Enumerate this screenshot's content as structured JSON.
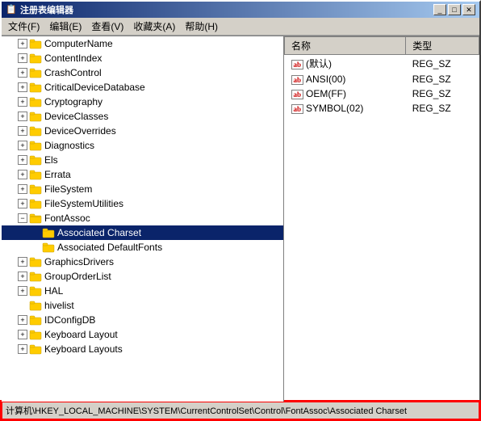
{
  "window": {
    "title": "注册表编辑器",
    "title_icon": "🗒"
  },
  "title_buttons": {
    "minimize": "_",
    "maximize": "□",
    "close": "✕"
  },
  "menu": {
    "items": [
      {
        "label": "文件(F)"
      },
      {
        "label": "编辑(E)"
      },
      {
        "label": "查看(V)"
      },
      {
        "label": "收藏夹(A)"
      },
      {
        "label": "帮助(H)"
      }
    ]
  },
  "tree": {
    "items": [
      {
        "id": "computerName",
        "label": "ComputerName",
        "depth": 1,
        "has_expand": true,
        "expanded": false,
        "selected": false
      },
      {
        "id": "contentIndex",
        "label": "ContentIndex",
        "depth": 1,
        "has_expand": true,
        "expanded": false,
        "selected": false
      },
      {
        "id": "crashControl",
        "label": "CrashControl",
        "depth": 1,
        "has_expand": true,
        "expanded": false,
        "selected": false
      },
      {
        "id": "criticalDeviceDatabase",
        "label": "CriticalDeviceDatabase",
        "depth": 1,
        "has_expand": true,
        "expanded": false,
        "selected": false
      },
      {
        "id": "cryptography",
        "label": "Cryptography",
        "depth": 1,
        "has_expand": true,
        "expanded": false,
        "selected": false
      },
      {
        "id": "deviceClasses",
        "label": "DeviceClasses",
        "depth": 1,
        "has_expand": true,
        "expanded": false,
        "selected": false
      },
      {
        "id": "deviceOverrides",
        "label": "DeviceOverrides",
        "depth": 1,
        "has_expand": true,
        "expanded": false,
        "selected": false
      },
      {
        "id": "diagnostics",
        "label": "Diagnostics",
        "depth": 1,
        "has_expand": true,
        "expanded": false,
        "selected": false
      },
      {
        "id": "els",
        "label": "Els",
        "depth": 1,
        "has_expand": true,
        "expanded": false,
        "selected": false
      },
      {
        "id": "errata",
        "label": "Errata",
        "depth": 1,
        "has_expand": true,
        "expanded": false,
        "selected": false
      },
      {
        "id": "fileSystem",
        "label": "FileSystem",
        "depth": 1,
        "has_expand": true,
        "expanded": false,
        "selected": false
      },
      {
        "id": "fileSystemUtilities",
        "label": "FileSystemUtilities",
        "depth": 1,
        "has_expand": true,
        "expanded": false,
        "selected": false
      },
      {
        "id": "fontAssoc",
        "label": "FontAssoc",
        "depth": 1,
        "has_expand": true,
        "expanded": true,
        "selected": false
      },
      {
        "id": "associatedCharset",
        "label": "Associated Charset",
        "depth": 2,
        "has_expand": false,
        "expanded": false,
        "selected": true
      },
      {
        "id": "associatedDefaultFonts",
        "label": "Associated DefaultFonts",
        "depth": 2,
        "has_expand": false,
        "expanded": false,
        "selected": false
      },
      {
        "id": "graphicsDrivers",
        "label": "GraphicsDrivers",
        "depth": 1,
        "has_expand": true,
        "expanded": false,
        "selected": false
      },
      {
        "id": "groupOrderList",
        "label": "GroupOrderList",
        "depth": 1,
        "has_expand": true,
        "expanded": false,
        "selected": false
      },
      {
        "id": "hal",
        "label": "HAL",
        "depth": 1,
        "has_expand": true,
        "expanded": false,
        "selected": false
      },
      {
        "id": "hivelist",
        "label": "hivelist",
        "depth": 1,
        "has_expand": false,
        "expanded": false,
        "selected": false
      },
      {
        "id": "idConfigDB",
        "label": "IDConfigDB",
        "depth": 1,
        "has_expand": true,
        "expanded": false,
        "selected": false
      },
      {
        "id": "keyboardLayout",
        "label": "Keyboard Layout",
        "depth": 1,
        "has_expand": true,
        "expanded": false,
        "selected": false
      },
      {
        "id": "keyboardLayouts",
        "label": "Keyboard Layouts",
        "depth": 1,
        "has_expand": true,
        "expanded": false,
        "selected": false
      }
    ]
  },
  "right_panel": {
    "columns": [
      "名称",
      "类型"
    ],
    "rows": [
      {
        "icon": "ab",
        "name": "(默认)",
        "type": "REG_SZ"
      },
      {
        "icon": "ab",
        "name": "ANSI(00)",
        "type": "REG_SZ"
      },
      {
        "icon": "ab",
        "name": "OEM(FF)",
        "type": "REG_SZ"
      },
      {
        "icon": "ab",
        "name": "SYMBOL(02)",
        "type": "REG_SZ"
      }
    ]
  },
  "status_bar": {
    "text": "计算机\\HKEY_LOCAL_MACHINE\\SYSTEM\\CurrentControlSet\\Control\\FontAssoc\\Associated Charset"
  }
}
